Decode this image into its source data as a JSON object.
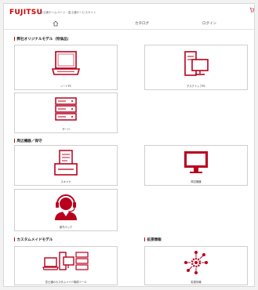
{
  "header": {
    "logo": "FUJITSU",
    "site_name": "富士通ホームページ・富士通サービスサイト",
    "nav": {
      "catalog": "カタログ",
      "login": "ログイン"
    }
  },
  "sections": {
    "original_models": {
      "title": "弊社オリジナルモデル（特価品）",
      "tiles": [
        "ノートPC",
        "デスクトップPC",
        "サーバ"
      ]
    },
    "peripherals": {
      "title": "周辺機器／保守",
      "tiles": [
        "スキャナ",
        "周辺機器",
        "保守パック"
      ]
    },
    "custom_models": {
      "title": "カスタムメイドモデル",
      "tiles": [
        "富士通のカスタムメイド構成ツール"
      ]
    },
    "extended_info": {
      "title": "拡張情報",
      "tiles": [
        "拡張情報"
      ]
    }
  },
  "colors": {
    "brand_red": "#cc0000",
    "icon_red": "#b8001e"
  },
  "icons": [
    "home-icon",
    "laptop-icon",
    "desktop-pc-icon",
    "server-icon",
    "scanner-icon",
    "monitor-icon",
    "support-headset-icon",
    "custom-build-icon",
    "network-gear-icon"
  ]
}
